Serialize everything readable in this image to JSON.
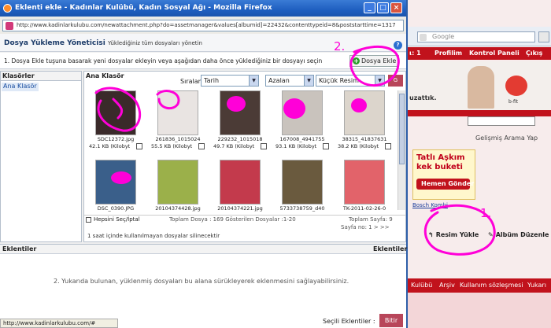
{
  "popup": {
    "title": "Eklenti ekle - Kadınlar Kulübü, Kadın Sosyal Ağı - Mozilla Firefox",
    "url": "http://www.kadinlarkulubu.com/newattachment.php?do=assetmanager&values[albumid]=22432&contenttypeid=8&poststarttime=1317",
    "header_title": "Dosya Yükleme Yöneticisi",
    "header_subtitle": "Yüklediğiniz tüm dosyaları yönetin",
    "instruction": "1. Dosya Ekle tuşuna basarak yeni dosyalar ekleyin veya aşağıdan daha önce yüklediğiniz bir dosyayı seçin",
    "dosya_ekle_label": "Dosya Ekle",
    "folders_header": "Klasörler",
    "folder_item": "Ana Klasör",
    "main_header": "Ana Klasör",
    "sort_label": "Sıralama:",
    "sort_by": "Tarih",
    "sort_order": "Azalan",
    "size_option": "Küçük Resim",
    "go_label": "G",
    "select_all": "Hepsini Seç/İptal",
    "totals": "Toplam Dosya : 169 Gösterilen Dosyalar :1-20",
    "total_pages": "Toplam Sayfa: 9",
    "page_nav": "Sayfa no: 1  >  >>",
    "cleanup_note": "1 saat içinde kullanılmayan dosyalar silinecektir",
    "attachments_header": "Eklentiler",
    "attachments_header_right": "Eklentiler",
    "attachments_hint": "2. Yukarıda bulunan, yüklenmiş dosyaları bu alana sürükleyerek eklenmesini sağlayabilirsiniz.",
    "selected_label": "Seçili Eklentiler :",
    "finish_label": "Bitir",
    "status_url": "http://www.kadinlarkulubu.com/#"
  },
  "files": [
    {
      "name": "SDC12372.jpg",
      "size": "42.1 KB (Kilobyt",
      "color": "#3a2a2a"
    },
    {
      "name": "261836_1015024",
      "size": "55.5 KB (Kilobyt",
      "color": "#e9e4e2"
    },
    {
      "name": "229232_1015018",
      "size": "49.7 KB (Kilobyt",
      "color": "#4b3b36"
    },
    {
      "name": "167008_4941755",
      "size": "93.1 KB (Kilobyt",
      "color": "#c9c3bd"
    },
    {
      "name": "38315_41837631",
      "size": "38.2 KB (Kilobyt",
      "color": "#dcd5cc"
    },
    {
      "name": "DSC_0390.JPG",
      "size": "",
      "color": "#3a5f8a"
    },
    {
      "name": "20104374428.jpg",
      "size": "",
      "color": "#9bb04a"
    },
    {
      "name": "20104374221.jpg",
      "size": "",
      "color": "#c33a4c"
    },
    {
      "name": "5733738759_d40",
      "size": "",
      "color": "#6a5a3e"
    },
    {
      "name": "TK-2011-02-26-0",
      "size": "",
      "color": "#e2636a"
    }
  ],
  "background_page": {
    "search_placeholder": "Google",
    "nav": [
      "ι: 1",
      "Profilim",
      "Kontrol Paneli",
      "Çıkış"
    ],
    "banner_text": "uzattık.",
    "bfit": "b-fit",
    "advanced_search": "Gelişmiş Arama Yap",
    "ad_line1": "Tatlı Aşkım",
    "ad_line2": "kek buketi",
    "ad_button": "Hemen Gönder",
    "ad_link": "Bosch Kombi",
    "upload_photo": "Resim Yükle",
    "edit_album": "Albüm Düzenle",
    "footer_nav": [
      "Kulübü",
      "Arşiv",
      "Kullanım sözleşmesi",
      "Yukarı"
    ]
  },
  "annotations": [
    "2.",
    "1."
  ],
  "colors": {
    "accent": "#b8465a",
    "annotation": "#ff00d8",
    "title_bar": "#1f5fc0"
  }
}
